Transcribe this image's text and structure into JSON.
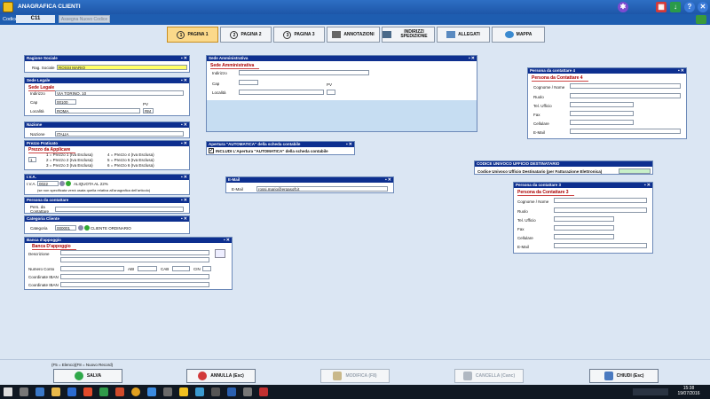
{
  "window": {
    "title": "ANAGRAFICA CLIENTI"
  },
  "codebar": {
    "label": "Codice",
    "value": "C11",
    "nuovo_label": "Assegna Nuovo Codice"
  },
  "tabs": [
    {
      "num": "1",
      "label": "PAGINA 1",
      "active": true
    },
    {
      "num": "2",
      "label": "PAGINA 2"
    },
    {
      "num": "3",
      "label": "PAGINA 3"
    },
    {
      "label": "ANNOTAZIONI"
    },
    {
      "label": "INDIRIZZI SPEDIZIONE"
    },
    {
      "label": "ALLEGATI"
    },
    {
      "label": "MAPPA"
    }
  ],
  "ragione_sociale": {
    "header": "Ragione Sociale",
    "label": "Rag. Sociale",
    "value": "ROSSI MARIO"
  },
  "sede_legale": {
    "header": "Sede Legale",
    "subtitle": "Sede Legale",
    "ind_label": "Indirizzo",
    "ind_value": "VIA TORINO, 10",
    "cap_label": "Cap",
    "cap_value": "00100",
    "loc_label": "Località",
    "loc_value": "ROMA",
    "pv_label": "PV",
    "pv_value": "RM"
  },
  "nazione": {
    "header": "Nazione",
    "label": "Nazione",
    "value": "ITALIA"
  },
  "prezzo": {
    "header": "Prezzo Praticato",
    "subtitle": "Prezzo da Applicare",
    "selected": "1",
    "left": [
      "1 = Prezzo 1 (Iva Esclusa)",
      "2 = Prezzo 2 (Iva Esclusa)",
      "3 = Prezzo 3 (Iva Esclusa)"
    ],
    "right": [
      "4 = Prezzo 4 (Iva Esclusa)",
      "5 = Prezzo 5 (Iva Esclusa)",
      "6 = Prezzo 6 (Iva Esclusa)"
    ]
  },
  "iva": {
    "header": "I.V.A.",
    "label": "I.V.A.",
    "value": "0022",
    "desc": "ALIQUOTA AL 22%",
    "note": "(se non specificata verrà usata quella relativa all'anagrafica dell'articolo)"
  },
  "contattare": {
    "header": "Persona da contattare",
    "label": "Pers. da Contattare"
  },
  "categoria": {
    "header": "Categoria Cliente",
    "label": "Categoria",
    "value": "000001",
    "desc": "CLIENTE ORDINARIO"
  },
  "banca": {
    "header": "Banca d'appoggio",
    "subtitle": "Banca D'appoggio",
    "desc_label": "Descrizione",
    "conto_label": "Numero Conto",
    "abi_label": "ABI",
    "cab_label": "CAB",
    "cin_label": "CIN",
    "iban1_label": "Coordinate IBAN",
    "iban2_label": "Coordinate IBAN"
  },
  "sede_amm": {
    "header": "Sede Amministrativa",
    "subtitle": "Sede Amministrativa",
    "ind_label": "Indirizzo",
    "cap_label": "Cap",
    "loc_label": "Località",
    "pv_label": "PV"
  },
  "apertura": {
    "header": "Apertura \"AUTOMATICA\" della scheda contabile",
    "label": "INCLUDI L'Apertura \"AUTOMATICA\" della scheda contabile"
  },
  "email": {
    "header": "E-Mail",
    "label": "E-Mail",
    "value": "rossi.mario@ergasoft.it"
  },
  "codice_univoco": {
    "header": "CODICE UNIVOCO UFFICIO DESTINATARIO",
    "label": "Codice Univoco Ufficio Destinatario (per Fatturazione Elettronica)"
  },
  "contatto4": {
    "header": "Persona da contattare 4",
    "subtitle": "Persona da Contattare 4",
    "fields": [
      "Cognome / Nome",
      "Ruolo",
      "Tel. Ufficio",
      "Fax",
      "Cellulare",
      "E-Mail"
    ]
  },
  "contatto3": {
    "header": "Persona da contattare 3",
    "subtitle": "Persona da Contattare 3",
    "fields": [
      "Cognome / Nome",
      "Ruolo",
      "Tel. Ufficio",
      "Fax",
      "Cellulare",
      "E-Mail"
    ]
  },
  "bottom": {
    "hint1": "(F5 = Elenco)",
    "hint2": "(F8 = Nuovo Record)",
    "salva": "SALVA",
    "annulla": "ANNULLA (Esc)",
    "modifica": "MODIFICA (F8)",
    "cancella": "CANCELLA (Canc)",
    "chiudi": "CHIUDI (Esc)"
  },
  "taskbar": {
    "time": "15:38",
    "date": "19/07/2016"
  },
  "colors": {
    "title": "#1d56a8",
    "header": "#0d2f8f",
    "highlight": "#ffff66",
    "active_tab": "#fbd98a"
  }
}
